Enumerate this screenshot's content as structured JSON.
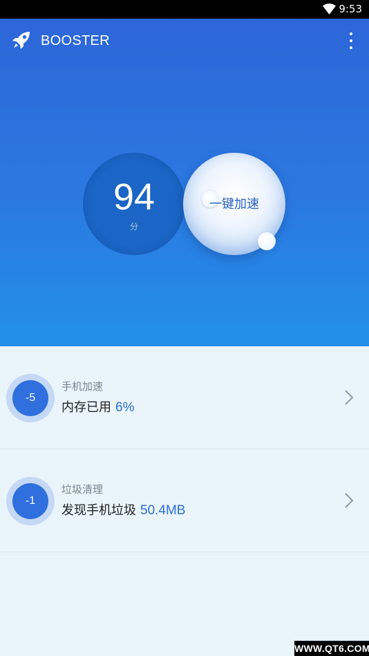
{
  "status_bar": {
    "time": "9:53",
    "wifi_icon": "wifi-icon"
  },
  "app_bar": {
    "title": "BOOSTER",
    "logo_icon": "rocket-icon",
    "menu_icon": "more-vert-icon"
  },
  "score": {
    "value": "94",
    "unit": "分"
  },
  "boost_button": {
    "label": "一键加速"
  },
  "tasks": [
    {
      "badge": "-5",
      "title": "手机加速",
      "detail_label": "内存已用",
      "detail_value": "6%"
    },
    {
      "badge": "-1",
      "title": "垃圾清理",
      "detail_label": "发现手机垃圾",
      "detail_value": "50.4MB"
    }
  ],
  "watermark": "WWW.QT6.COM",
  "colors": {
    "hero_top": "#2d66d9",
    "hero_bottom": "#2290e8",
    "score_circle": "#1a65c5",
    "badge": "#2f6fde",
    "highlight": "#2b6fd6",
    "background": "#eaf4fb"
  }
}
